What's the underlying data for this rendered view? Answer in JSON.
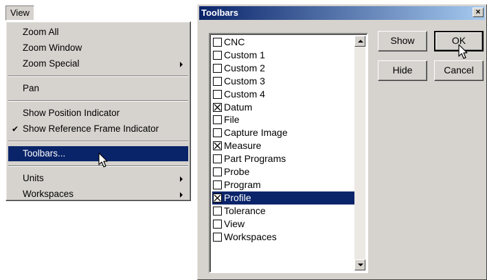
{
  "menu": {
    "title": "View",
    "groups": [
      [
        {
          "label": "Zoom All",
          "checked": false,
          "submenu": false
        },
        {
          "label": "Zoom Window",
          "checked": false,
          "submenu": false
        },
        {
          "label": "Zoom Special",
          "checked": false,
          "submenu": true
        }
      ],
      [
        {
          "label": "Pan",
          "checked": false,
          "submenu": false
        }
      ],
      [
        {
          "label": "Show Position Indicator",
          "checked": false,
          "submenu": false
        },
        {
          "label": "Show Reference Frame Indicator",
          "checked": true,
          "submenu": false
        }
      ],
      [
        {
          "label": "Toolbars...",
          "checked": false,
          "submenu": false,
          "highlighted": true
        }
      ],
      [
        {
          "label": "Units",
          "checked": false,
          "submenu": true
        },
        {
          "label": "Workspaces",
          "checked": false,
          "submenu": true
        }
      ]
    ]
  },
  "dialog": {
    "title": "Toolbars",
    "close_label": "×",
    "items": [
      {
        "label": "CNC",
        "checked": false
      },
      {
        "label": "Custom 1",
        "checked": false
      },
      {
        "label": "Custom 2",
        "checked": false
      },
      {
        "label": "Custom 3",
        "checked": false
      },
      {
        "label": "Custom 4",
        "checked": false
      },
      {
        "label": "Datum",
        "checked": true
      },
      {
        "label": "File",
        "checked": false
      },
      {
        "label": "Capture Image",
        "checked": false
      },
      {
        "label": "Measure",
        "checked": true
      },
      {
        "label": "Part Programs",
        "checked": false
      },
      {
        "label": "Probe",
        "checked": false
      },
      {
        "label": "Program",
        "checked": false
      },
      {
        "label": "Profile",
        "checked": true,
        "selected": true
      },
      {
        "label": "Tolerance",
        "checked": false
      },
      {
        "label": "View",
        "checked": false
      },
      {
        "label": "Workspaces",
        "checked": false
      }
    ],
    "buttons": {
      "show": "Show",
      "ok": "OK",
      "hide": "Hide",
      "cancel": "Cancel"
    }
  },
  "colors": {
    "highlight": "#0a246a",
    "face": "#d6d3ce"
  },
  "icons": {
    "checkmark": "check-icon",
    "submenu_arrow": "submenu-arrow-icon",
    "cursor": "mouse-pointer-icon"
  }
}
